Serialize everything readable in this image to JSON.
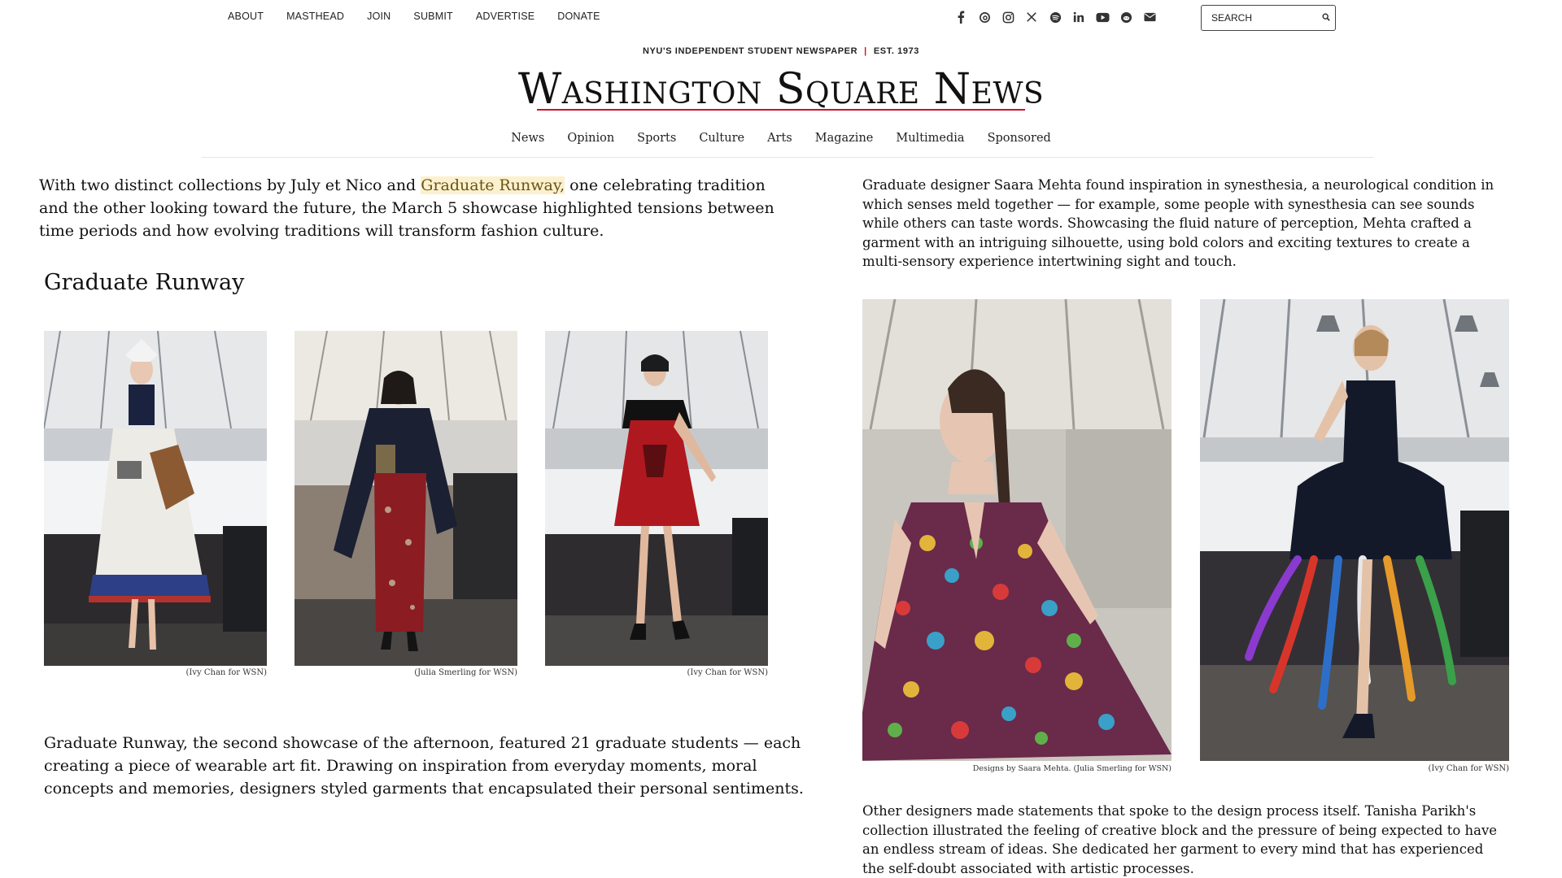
{
  "top_nav": [
    "ABOUT",
    "MASTHEAD",
    "JOIN",
    "SUBMIT",
    "ADVERTISE",
    "DONATE"
  ],
  "social_icons": [
    "facebook-icon",
    "threads-icon",
    "instagram-icon",
    "x-icon",
    "spotify-icon",
    "linkedin-icon",
    "youtube-icon",
    "reddit-icon",
    "email-icon"
  ],
  "search": {
    "placeholder": "SEARCH"
  },
  "masthead": {
    "tagline_left": "NYU'S INDEPENDENT STUDENT NEWSPAPER",
    "tagline_sep": "|",
    "tagline_right": "EST. 1973",
    "title": "Washington Square News",
    "accent_color": "#c8102e"
  },
  "main_nav": [
    "News",
    "Opinion",
    "Sports",
    "Culture",
    "Arts",
    "Magazine",
    "Multimedia",
    "Sponsored"
  ],
  "left": {
    "lede_before": "With two distinct collections by July et Nico and ",
    "lede_link": "Graduate Runway,",
    "lede_after": " one celebrating tradition and the other looking toward the future, the March 5 showcase highlighted tensions between time periods and how evolving traditions will transform fashion culture.",
    "section_heading": "Graduate Runway",
    "photos": [
      {
        "credit": "(Ivy Chan for WSN)"
      },
      {
        "credit": "(Julia Smerling for WSN)"
      },
      {
        "credit": "(Ivy Chan for WSN)"
      }
    ],
    "body": "Graduate Runway, the second showcase of the afternoon, featured 21 graduate students — each creating a piece of wearable art fit. Drawing on inspiration from everyday moments, moral concepts and memories, designers styled garments that encapsulated their personal sentiments."
  },
  "right": {
    "para1": "Graduate designer Saara Mehta found inspiration in synesthesia, a neurological condition in which senses meld together — for example, some people with synesthesia can see sounds while others can taste words. Showcasing the fluid nature of perception, Mehta crafted a garment with an intriguing silhouette, using bold colors and exciting textures to create a multi-sensory experience intertwining sight and touch.",
    "photos": [
      {
        "credit": "Designs by Saara Mehta. (Julia Smerling for WSN)"
      },
      {
        "credit": "(Ivy Chan for WSN)"
      }
    ],
    "para2": "Other designers made statements that spoke to the design process itself. Tanisha Parikh's collection illustrated the feeling of creative block and the pressure of being expected to have an endless stream of ideas. She dedicated her garment to every mind that has experienced the self-doubt associated with artistic processes."
  }
}
